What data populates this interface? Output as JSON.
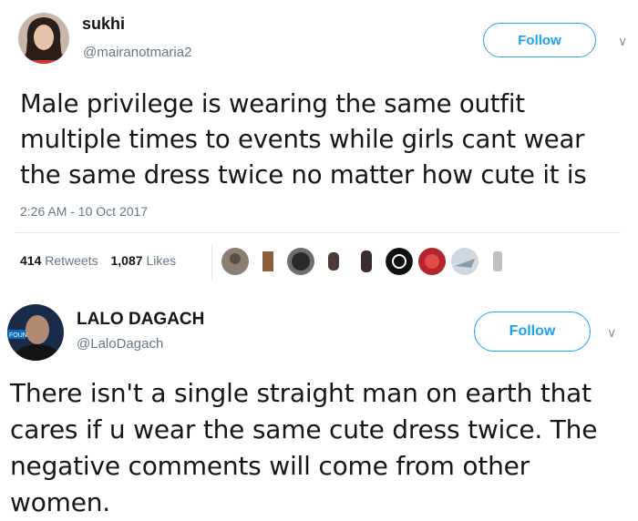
{
  "tweet1": {
    "display_name": "sukhi",
    "handle": "@mairanotmaria2",
    "follow_label": "Follow",
    "text_lines": [
      "Male privilege is wearing the same outfit",
      "multiple times to events while girls cant wear",
      "the same dress twice  no matter how cute it is"
    ],
    "timestamp": "2:26 AM - 10 Oct 2017",
    "retweets_count": "414",
    "retweets_label": "Retweets",
    "likes_count": "1,087",
    "likes_label": "Likes"
  },
  "tweet2": {
    "display_name": "LALO DAGACH",
    "handle": "@LaloDagach",
    "follow_label": "Follow",
    "avatar_badge": "FOUN",
    "text_lines": [
      "There isn't a single straight man on earth that",
      "cares if u wear the same cute dress twice. The",
      "negative comments will come from other",
      "women."
    ]
  },
  "icons": {
    "chevron": "∨"
  },
  "colors": {
    "follow_blue": "#1da1f2",
    "secondary_text": "#657786",
    "divider": "#e1e8ed"
  }
}
